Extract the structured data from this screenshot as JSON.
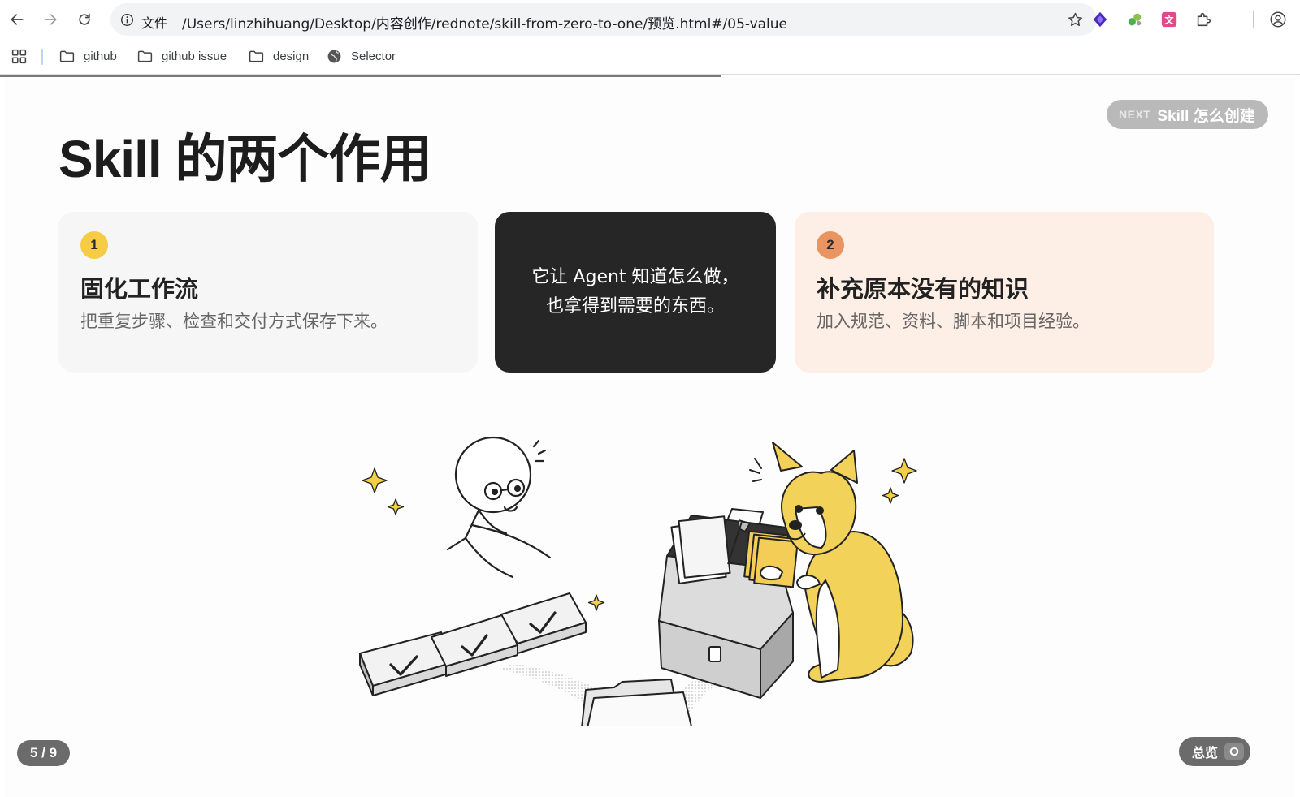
{
  "browser": {
    "scheme_label": "文件",
    "url": "/Users/linzhihuang/Desktop/内容创作/rednote/skill-from-zero-to-one/预览.html#/05-value",
    "bookmarks": [
      {
        "label": "github",
        "icon": "folder-icon"
      },
      {
        "label": "github issue",
        "icon": "folder-icon"
      },
      {
        "label": "design",
        "icon": "folder-icon"
      },
      {
        "label": "Selector",
        "icon": "globe-icon"
      }
    ],
    "reading_progress": 0.555
  },
  "slide": {
    "title": "Skill 的两个作用",
    "next": {
      "kicker": "NEXT",
      "label": "Skill 怎么创建"
    },
    "cards": [
      {
        "number": "1",
        "title": "固化工作流",
        "desc": "把重复步骤、检查和交付方式保存下来。"
      },
      {
        "line1": "它让 Agent 知道怎么做，",
        "line2": "也拿得到需要的东西。"
      },
      {
        "number": "2",
        "title": "补充原本没有的知识",
        "desc": "加入规范、资料、脚本和项目经验。"
      }
    ],
    "pager": "5 / 9",
    "overview": {
      "label": "总览",
      "key": "O"
    }
  },
  "colors": {
    "badge_yellow": "#f6cc44",
    "badge_orange": "#e99461",
    "dark_card": "#262626",
    "peach_card": "#fdeee6"
  }
}
